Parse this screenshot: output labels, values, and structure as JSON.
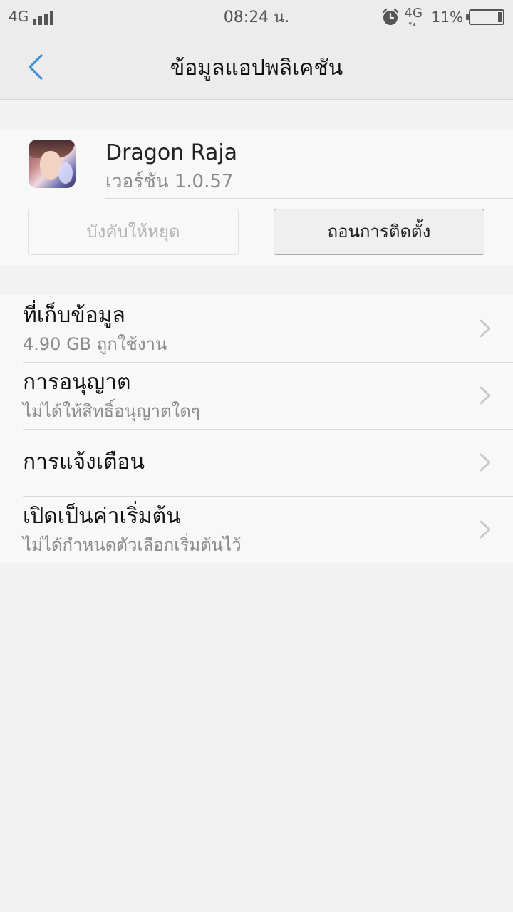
{
  "status_bar": {
    "network_left": "4G",
    "time": "08:24 น.",
    "network_right": "4G",
    "battery_percent": "11%",
    "battery_level": 0.11,
    "icons": [
      "signal-icon",
      "alarm-icon",
      "data-arrows-icon",
      "battery-icon"
    ]
  },
  "header": {
    "title": "ข้อมูลแอปพลิเคชัน",
    "back_icon": "chevron-left-icon",
    "accent_color": "#3d8fd6"
  },
  "app": {
    "name": "Dragon Raja",
    "version": "เวอร์ชัน 1.0.57",
    "force_stop_label": "บังคับให้หยุด",
    "force_stop_enabled": false,
    "uninstall_label": "ถอนการติดตั้ง"
  },
  "settings": {
    "items": [
      {
        "title": "ที่เก็บข้อมูล",
        "subtitle": "4.90 GB ถูกใช้งาน"
      },
      {
        "title": "การอนุญาต",
        "subtitle": "ไม่ได้ให้สิทธิ์อนุญาตใดๆ"
      },
      {
        "title": "การแจ้งเตือน",
        "subtitle": ""
      },
      {
        "title": "เปิดเป็นค่าเริ่มต้น",
        "subtitle": "ไม่ได้กำหนดตัวเลือกเริ่มต้นไว้"
      }
    ]
  }
}
